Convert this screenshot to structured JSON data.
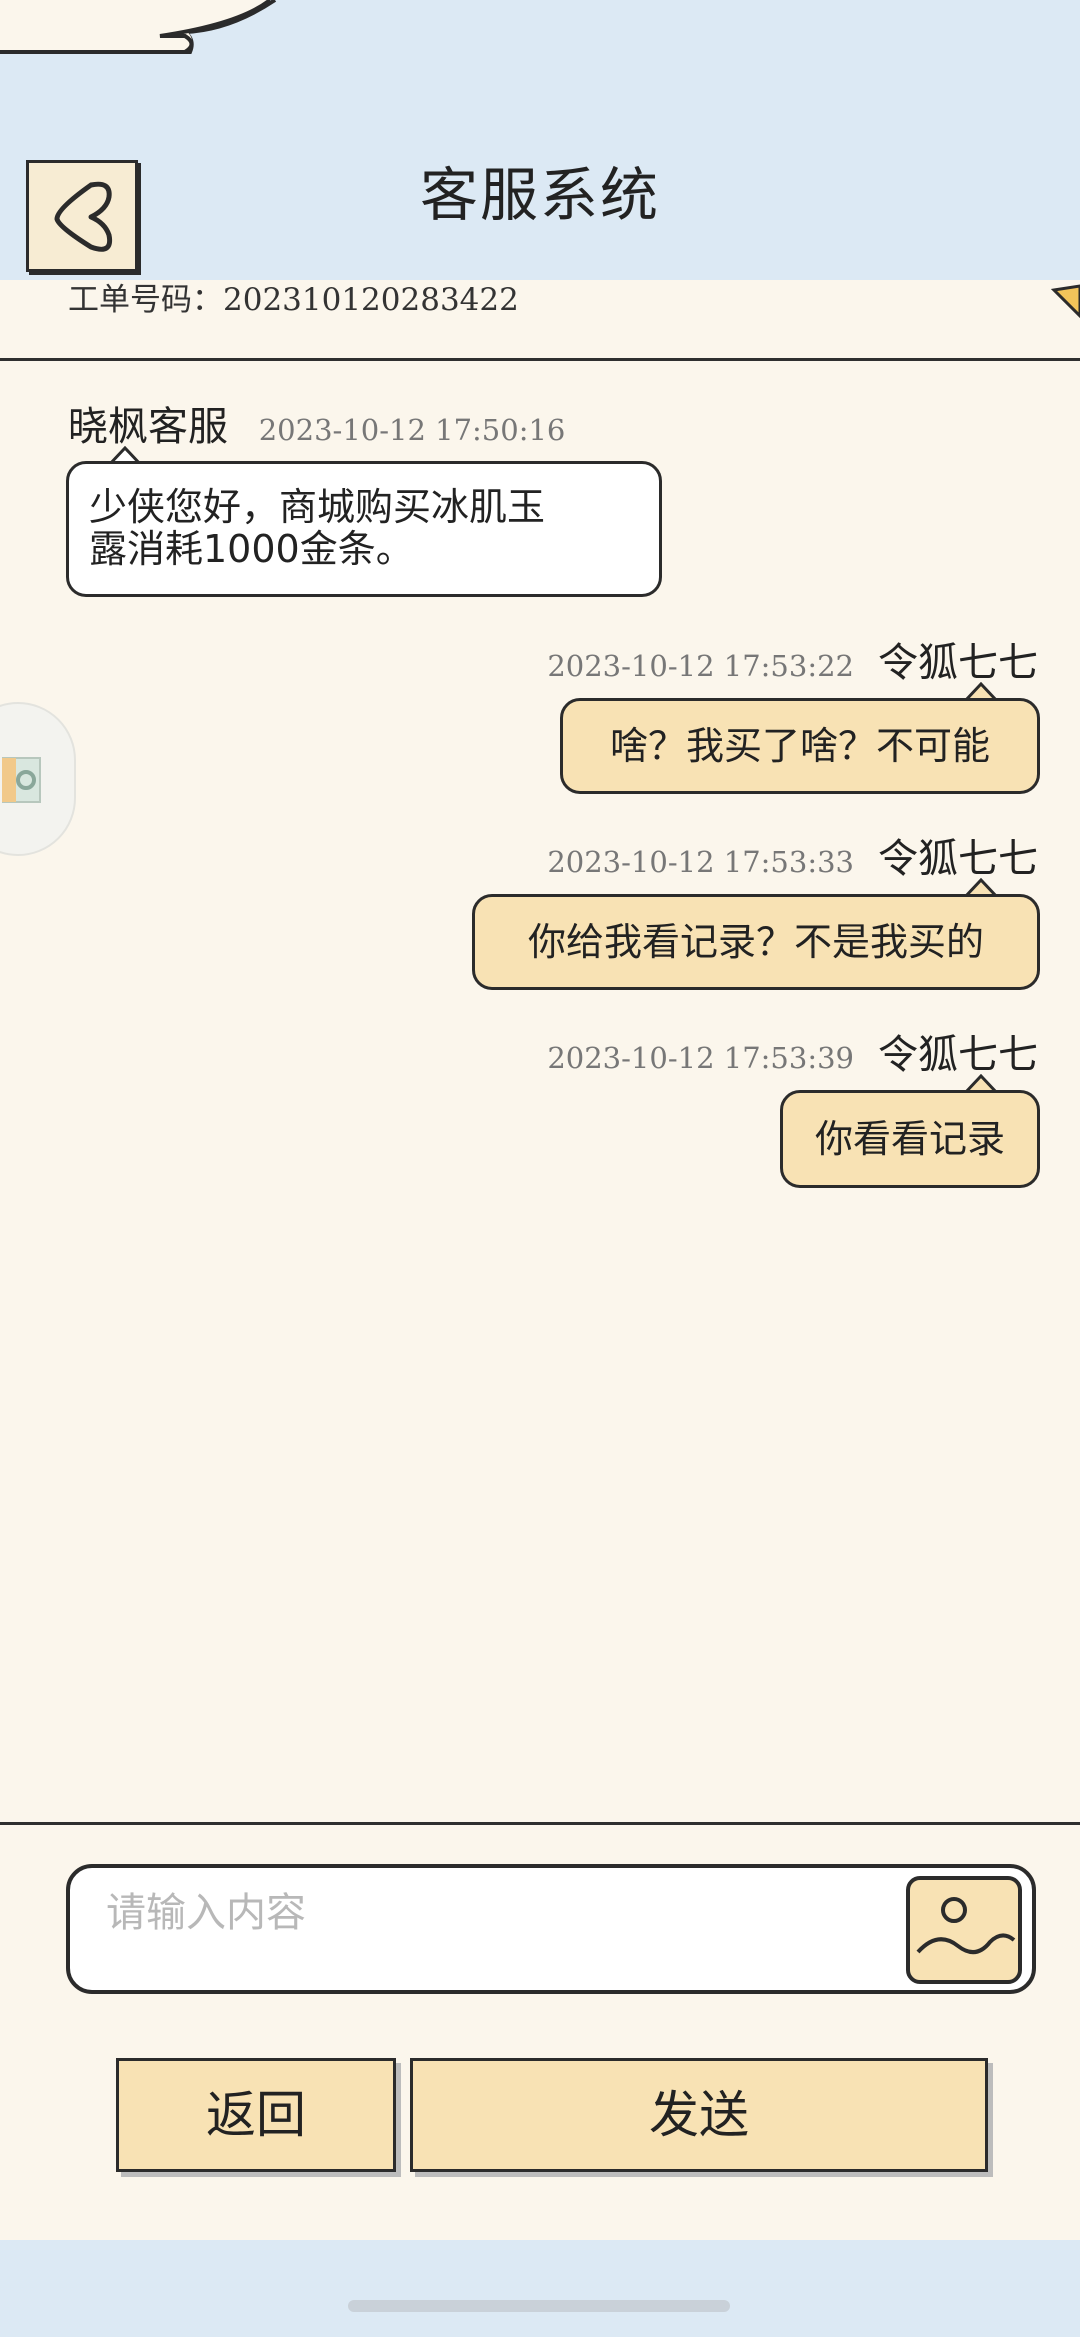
{
  "header": {
    "title": "客服系统"
  },
  "ticket": {
    "label": "工单号码：",
    "number": "202310120283422"
  },
  "messages": [
    {
      "side": "left",
      "sender": "晓枫客服",
      "time": "2023-10-12 17:50:16",
      "lines": [
        "少侠您好，商城购买冰肌玉",
        "露消耗1000金条。"
      ]
    },
    {
      "side": "right",
      "sender": "令狐七七",
      "time": "2023-10-12 17:53:22",
      "text": "啥？我买了啥？不可能"
    },
    {
      "side": "right",
      "sender": "令狐七七",
      "time": "2023-10-12 17:53:33",
      "text": "你给我看记录？不是我买的"
    },
    {
      "side": "right",
      "sender": "令狐七七",
      "time": "2023-10-12 17:53:39",
      "text": "你看看记录"
    }
  ],
  "input": {
    "placeholder": "请输入内容"
  },
  "buttons": {
    "back": "返回",
    "send": "发送"
  },
  "colors": {
    "header_bg": "#dce9f4",
    "page_bg": "#fbf6ec",
    "accent": "#f8e2b4",
    "outline": "#2b2b2b"
  },
  "icons": {
    "back": "back-arrow-icon",
    "image": "image-icon",
    "corner": "triangle-icon"
  }
}
